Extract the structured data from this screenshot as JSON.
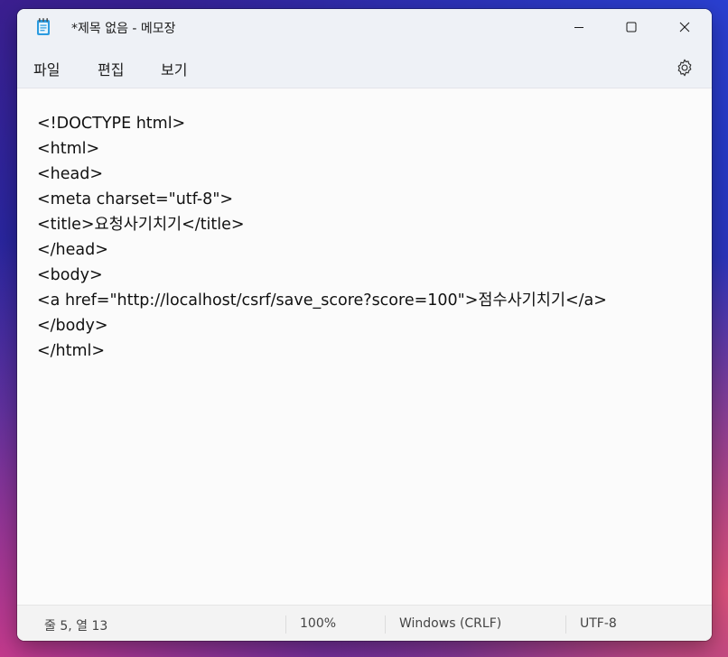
{
  "window": {
    "title": "*제목 없음 - 메모장",
    "app_icon": "notepad-icon",
    "controls": [
      "minimize-icon",
      "maximize-icon",
      "close-icon"
    ]
  },
  "menu": {
    "file": "파일",
    "edit": "편집",
    "view": "보기",
    "settings_icon": "gear-icon"
  },
  "editor": {
    "lines": [
      "<!DOCTYPE html>",
      "<html>",
      "<head>",
      "<meta charset=\"utf-8\">",
      "<title>요청사기치기</title>",
      "</head>",
      "<body>",
      "<a href=\"http://localhost/csrf/save_score?score=100\">점수사기치기</a>",
      "</body>",
      "</html>"
    ]
  },
  "status": {
    "position": "줄 5, 열 13",
    "zoom": "100%",
    "line_ending": "Windows (CRLF)",
    "encoding": "UTF-8"
  }
}
